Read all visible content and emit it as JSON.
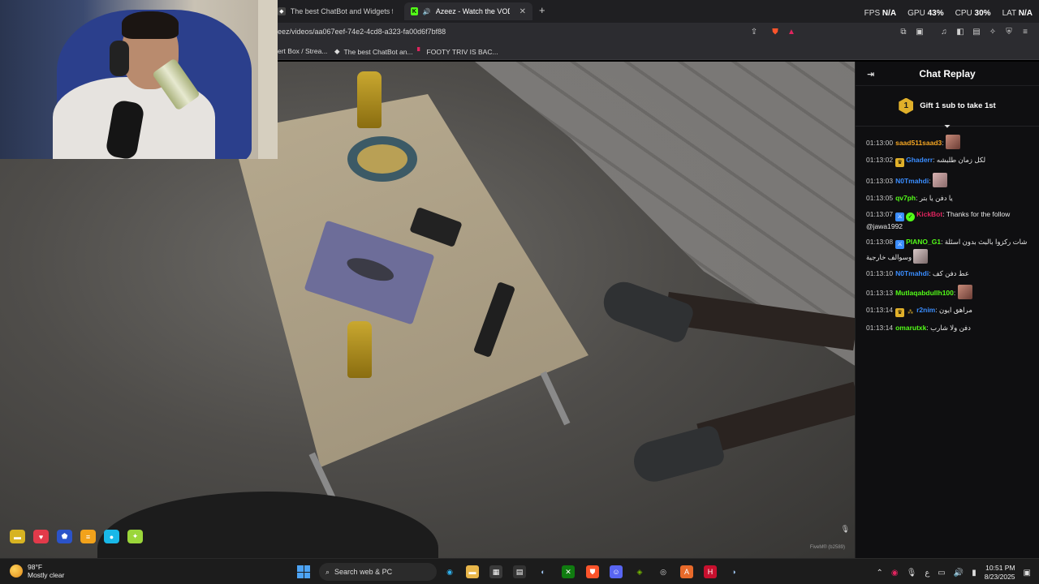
{
  "browser": {
    "tabs": [
      {
        "label": "The best ChatBot and Widgets for Ki",
        "active": false
      },
      {
        "label": "Azeez - Watch the VOD on Ki",
        "active": true
      }
    ],
    "url": "eez/videos/aa067eef-74e2-4cd8-a323-fa00d6f7bf88",
    "bookmarks": [
      {
        "label": "ert Box / Strea..."
      },
      {
        "label": "The best ChatBot an..."
      },
      {
        "label": "FOOTY TRIV IS BAC..."
      }
    ]
  },
  "perf": {
    "fps_label": "FPS",
    "fps_value": "N/A",
    "gpu_label": "GPU",
    "gpu_value": "43",
    "cpu_label": "CPU",
    "cpu_value": "30",
    "lat_label": "LAT",
    "lat_value": "N/A"
  },
  "chat": {
    "title": "Chat Replay",
    "gift_badge": "1",
    "gift_text": "Gift 1 sub to take 1st",
    "messages": [
      {
        "ts": "01:13:00",
        "user": "saad511saad3",
        "color": "#f5a623",
        "text": ""
      },
      {
        "ts": "01:13:02",
        "user": "Ghaderr",
        "color": "#3a8dff",
        "text": "لكل زمان طلبشه"
      },
      {
        "ts": "01:13:03",
        "user": "N0Tmahdi",
        "color": "#3a8dff",
        "text": ""
      },
      {
        "ts": "01:13:05",
        "user": "qv7ph",
        "color": "#53fc18",
        "text": "يا دفن يا بتر"
      },
      {
        "ts": "01:13:07",
        "user": "KickBot",
        "color": "#e0245e",
        "text": "Thanks for the follow @jawa1992"
      },
      {
        "ts": "01:13:08",
        "user": "PIANO_G1",
        "color": "#53fc18",
        "text": "شات ركزوا بالبث بدون اسئلة وسوالف خارجية"
      },
      {
        "ts": "01:13:10",
        "user": "N0Tmahdi",
        "color": "#3a8dff",
        "text": "عط دفن كف"
      },
      {
        "ts": "01:13:13",
        "user": "Mutlaqabdullh100",
        "color": "#53fc18",
        "text": ""
      },
      {
        "ts": "01:13:14",
        "user": "r2nim",
        "color": "#3a8dff",
        "text": "مراهق ايون"
      },
      {
        "ts": "01:13:14",
        "user": "omarutxk",
        "color": "#53fc18",
        "text": "دفن ولا شارب"
      }
    ]
  },
  "taskbar": {
    "weather_temp": "98°F",
    "weather_desc": "Mostly clear",
    "search_placeholder": "Search web & PC",
    "time": "10:51 PM",
    "date": "8/23/2025",
    "lang": "ع"
  },
  "video": {
    "watermark": "FiveM® (b2589)"
  }
}
